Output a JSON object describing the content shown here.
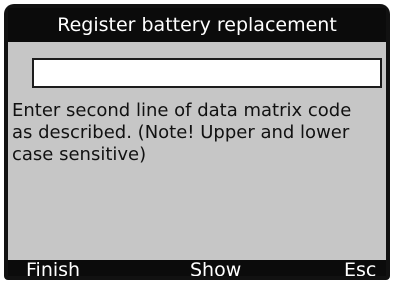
{
  "header": {
    "title": "Register battery replacement"
  },
  "input": {
    "value": ""
  },
  "message": {
    "lines": [
      "Enter second line of data matrix code",
      "as described. (Note! Upper and lower",
      "case sensitive)"
    ]
  },
  "softkeys": {
    "left_label": "Finish",
    "center_label": "Show",
    "right_label": "Esc"
  },
  "colors": {
    "screen_background": "#c6c6c6",
    "bar_background": "#0b0b0b",
    "bar_text": "#ffffff"
  }
}
